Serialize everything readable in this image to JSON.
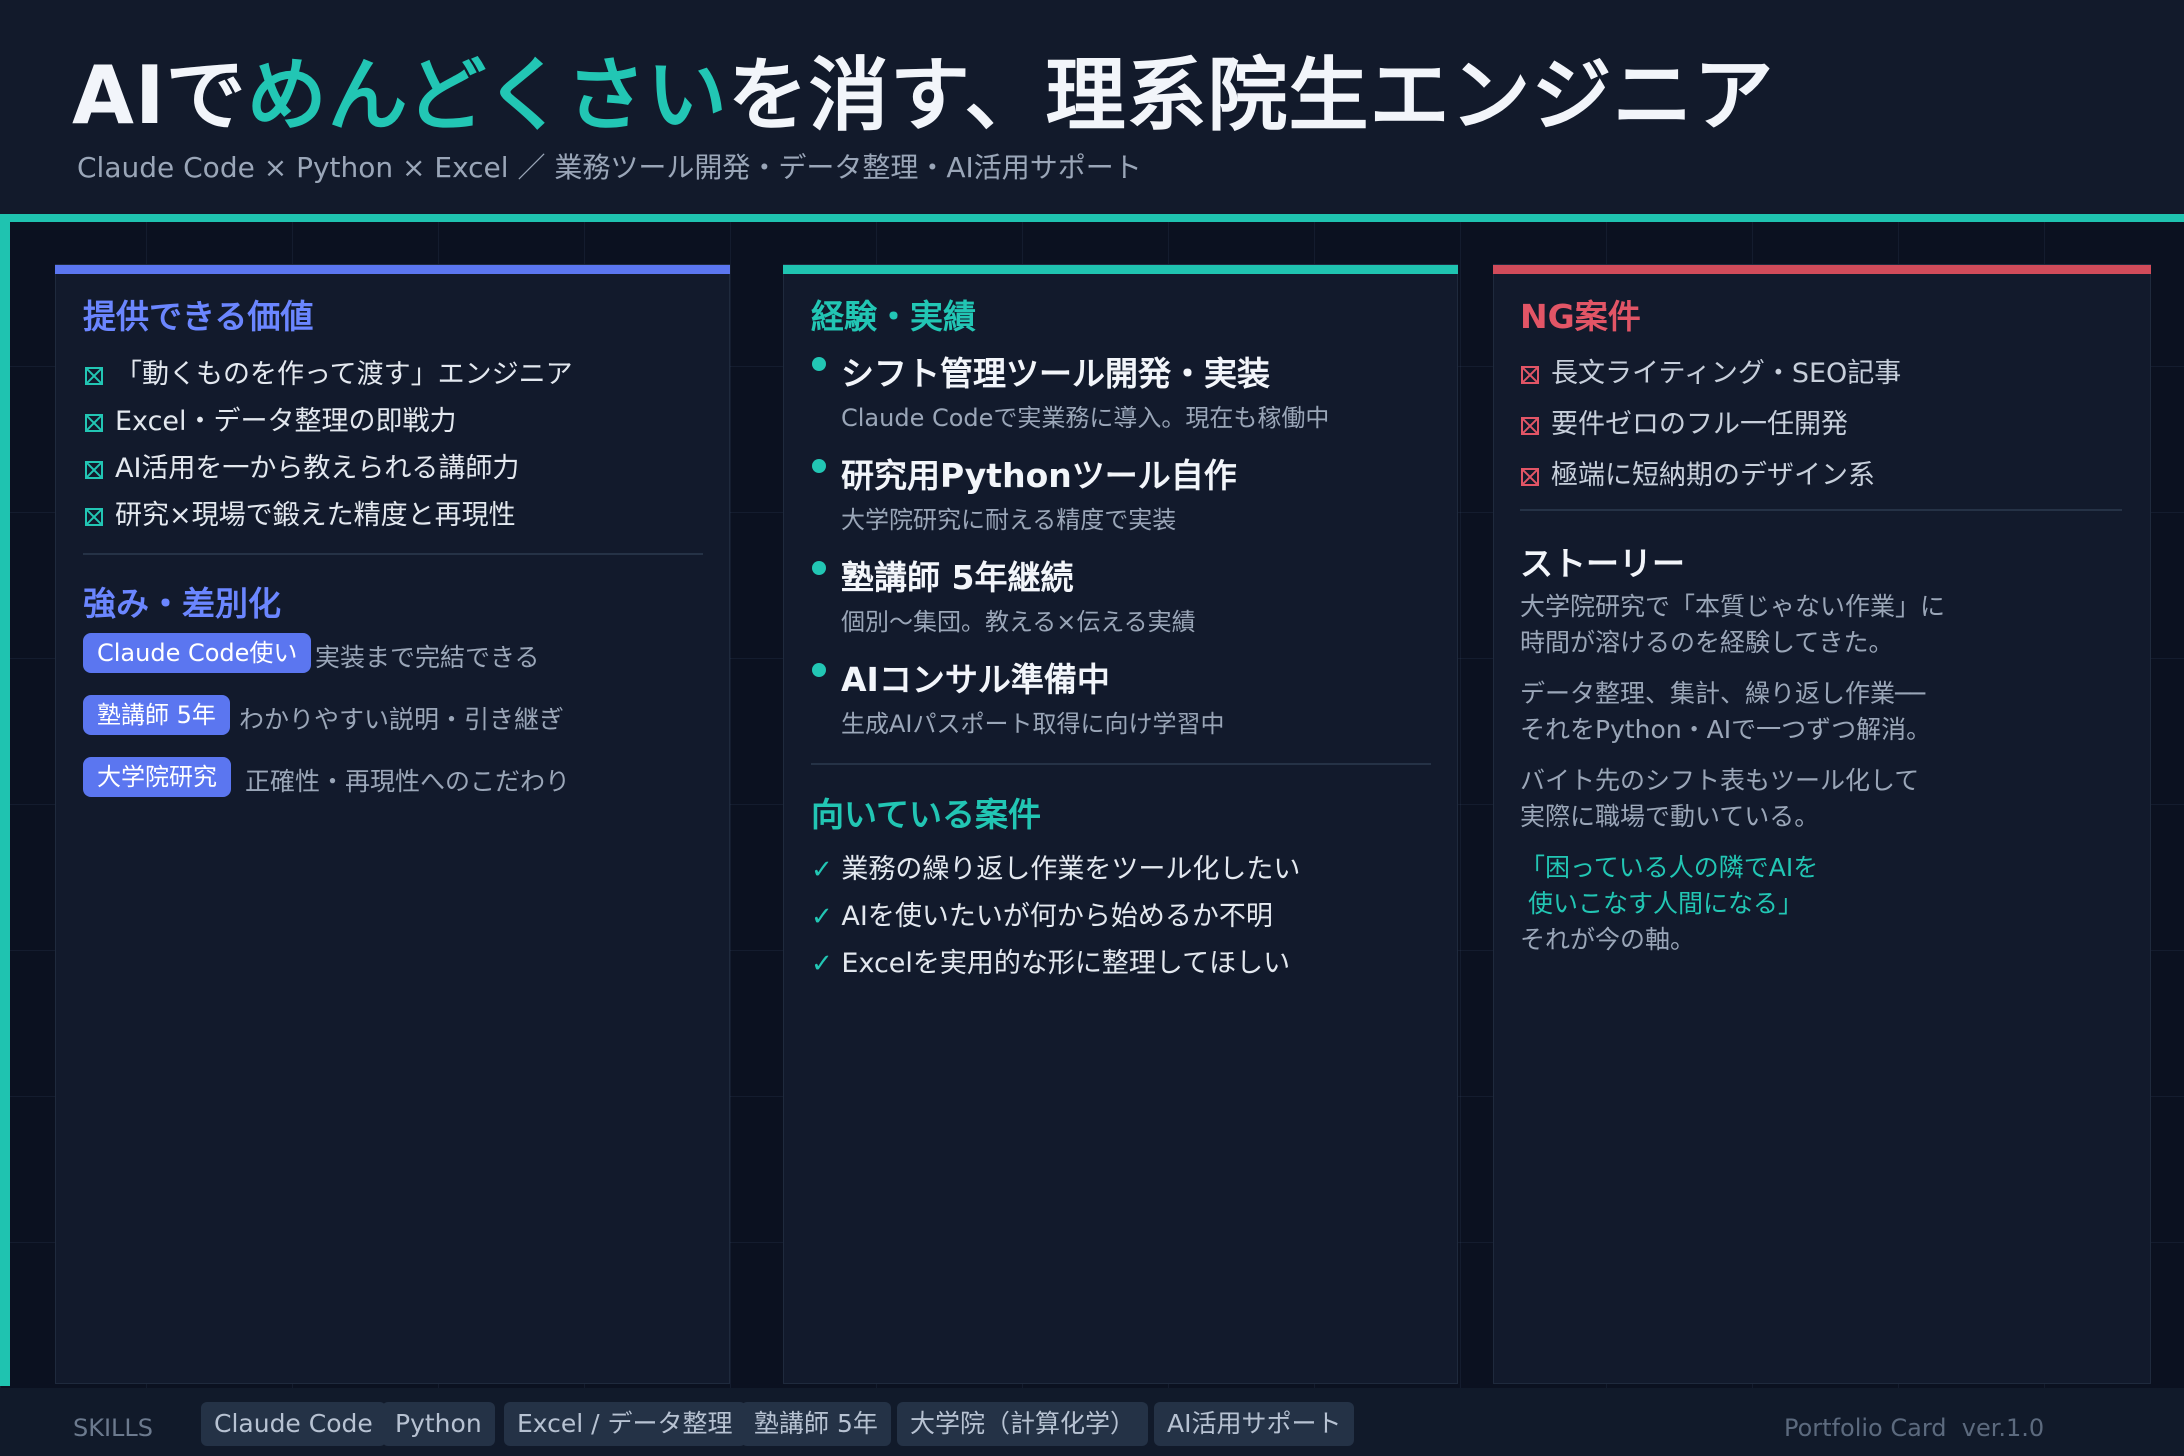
{
  "header": {
    "title_prefix": "AIで",
    "title_accent": "めんどくさい",
    "title_suffix": "を消す、理系院生エンジニア",
    "subtitle": "Claude Code × Python × Excel ／ 業務ツール開発・データ整理・AI活用サポート"
  },
  "value_card": {
    "title": "提供できる価値",
    "items": [
      "「動くものを作って渡す」エンジニア",
      "Excel・データ整理の即戦力",
      "AI活用を一から教えられる講師力",
      "研究×現場で鍛えた精度と再現性"
    ],
    "strengths_title": "強み・差別化",
    "strengths": [
      {
        "tag": "Claude Code使い",
        "desc": "実装まで完結できる"
      },
      {
        "tag": "塾講師 5年",
        "desc": "わかりやすい説明・引き継ぎ"
      },
      {
        "tag": "大学院研究",
        "desc": "正確性・再現性へのこだわり"
      }
    ]
  },
  "experience_card": {
    "title": "経験・実績",
    "items": [
      {
        "title": "シフト管理ツール開発・実装",
        "desc": "Claude Codeで実業務に導入。現在も稼働中"
      },
      {
        "title": "研究用Pythonツール自作",
        "desc": "大学院研究に耐える精度で実装"
      },
      {
        "title": "塾講師 5年継続",
        "desc": "個別〜集団。教える×伝える実績"
      },
      {
        "title": "AIコンサル準備中",
        "desc": "生成AIパスポート取得に向け学習中"
      }
    ],
    "fit_title": "向いている案件",
    "fit_items": [
      "業務の繰り返し作業をツール化したい",
      "AIを使いたいが何から始めるか不明",
      "Excelを実用的な形に整理してほしい"
    ]
  },
  "ng_card": {
    "title": "NG案件",
    "items": [
      "長文ライティング・SEO記事",
      "要件ゼロのフル一任開発",
      "極端に短納期のデザイン系"
    ],
    "story_title": "ストーリー",
    "story_p1": [
      "大学院研究で「本質じゃない作業」に",
      "時間が溶けるのを経験してきた。"
    ],
    "story_p2": [
      "データ整理、集計、繰り返し作業──",
      "それをPython・AIで一つずつ解消。"
    ],
    "story_p3": [
      "バイト先のシフト表もツール化して",
      "実際に職場で動いている。"
    ],
    "quote": [
      "「困っている人の隣でAIを",
      " 使いこなす人間になる」"
    ],
    "closing": "それが今の軸。"
  },
  "footer": {
    "skills_label": "SKILLS",
    "skills": [
      "Claude Code",
      "Python",
      "Excel / データ整理",
      "塾講師 5年",
      "大学院（計算化学）",
      "AI活用サポート"
    ],
    "note": "Portfolio Card  ver.1.0"
  },
  "colors": {
    "background": "#0b1120",
    "accent_teal": "#1fc3b0",
    "accent_blue": "#5b76f0",
    "accent_red": "#d14b5a"
  }
}
